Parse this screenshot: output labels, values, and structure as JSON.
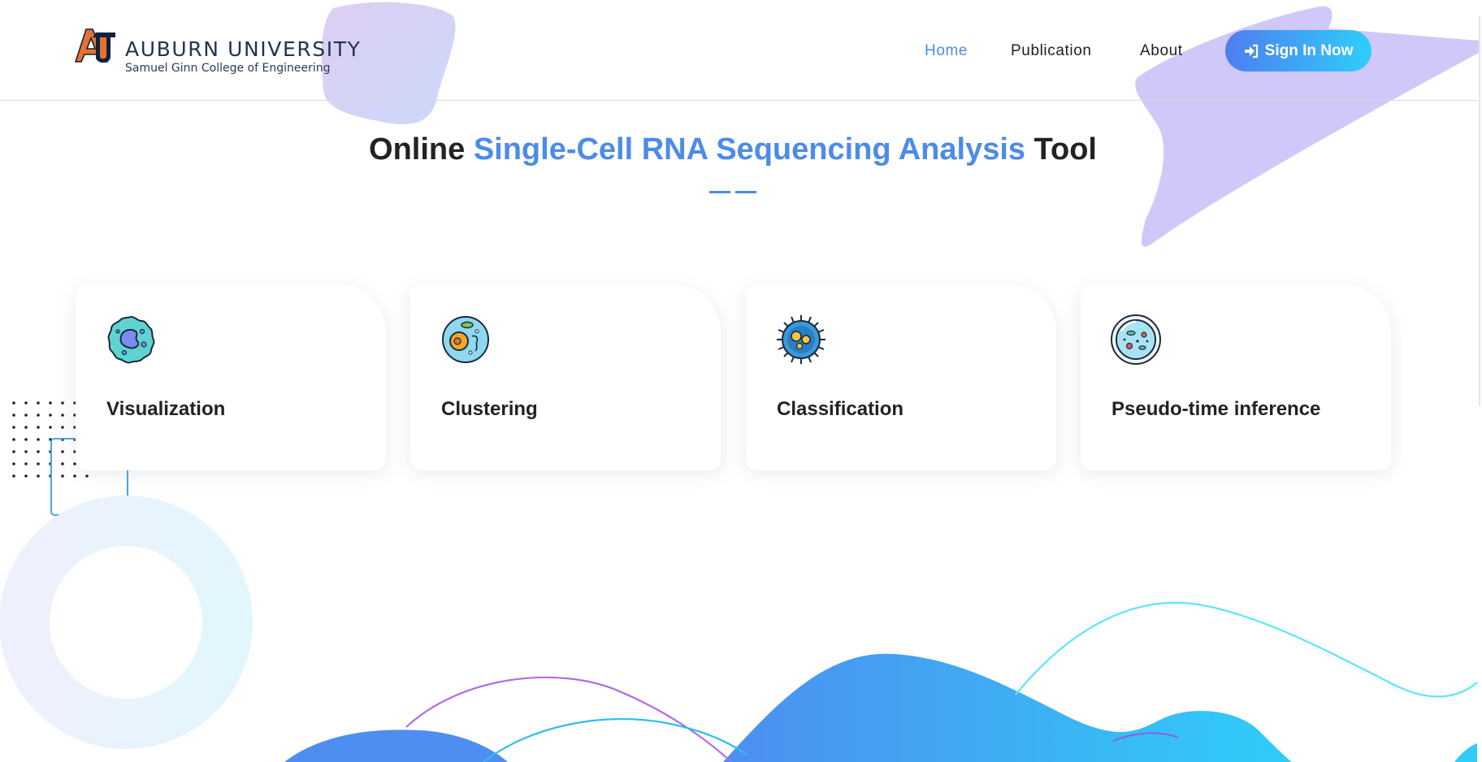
{
  "header": {
    "logo": {
      "title": "AUBURN UNIVERSITY",
      "subtitle": "Samuel Ginn College of Engineering",
      "mark_icon": "au-monogram-icon"
    },
    "nav": [
      {
        "label": "Home",
        "active": true
      },
      {
        "label": "Publication",
        "active": false
      },
      {
        "label": "About",
        "active": false
      }
    ],
    "signin": {
      "label": "Sign In Now",
      "icon": "sign-in-icon"
    }
  },
  "hero": {
    "title_prefix": "Online ",
    "title_accent": "Single-Cell RNA Sequencing Analysis",
    "title_suffix": " Tool"
  },
  "features": [
    {
      "label": "Visualization",
      "icon": "cell-icon"
    },
    {
      "label": "Clustering",
      "icon": "eukaryotic-cell-icon"
    },
    {
      "label": "Classification",
      "icon": "virus-cell-icon"
    },
    {
      "label": "Pseudo-time inference",
      "icon": "petri-dish-icon"
    }
  ],
  "colors": {
    "accent": "#4c8bea",
    "button_start": "#4e7ef0",
    "button_end": "#2fcdfa",
    "text": "#232323"
  }
}
